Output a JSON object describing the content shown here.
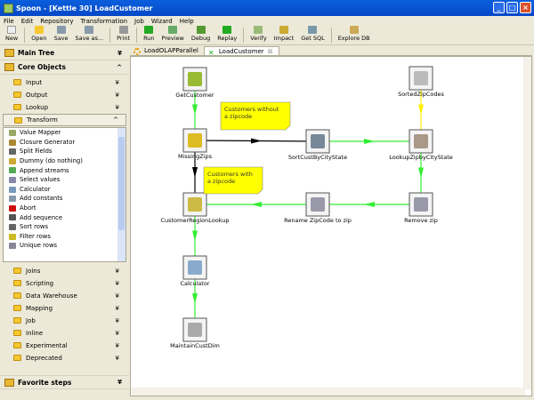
{
  "window": {
    "title": "Spoon - [Kettle 30] LoadCustomer"
  },
  "menu": [
    "File",
    "Edit",
    "Repository",
    "Transformation",
    "Job",
    "Wizard",
    "Help"
  ],
  "toolbar": [
    "New",
    "Open",
    "Save",
    "Save as...",
    "Print",
    "Run",
    "Preview",
    "Debug",
    "Replay",
    "Verify",
    "Impact",
    "Get SQL",
    "Explore DB"
  ],
  "left": {
    "main_tree": "Main Tree",
    "core_objects": "Core Objects",
    "categories_top": [
      "Input",
      "Output",
      "Lookup"
    ],
    "transform": "Transform",
    "transform_items": [
      "Value Mapper",
      "Closure Generator",
      "Split Fields",
      "Dummy (do nothing)",
      "Append streams",
      "Select values",
      "Calculator",
      "Add constants",
      "Abort",
      "Add sequence",
      "Sort rows",
      "Filter rows",
      "Unique rows"
    ],
    "categories_bottom": [
      "Joins",
      "Scripting",
      "Data Warehouse",
      "Mapping",
      "Job",
      "Inline",
      "Experimental",
      "Deprecated"
    ],
    "favorite": "Favorite steps"
  },
  "tabs": [
    "LoadOLAPParallel",
    "LoadCustomer"
  ],
  "steps": {
    "get_customer": "GetCustomer",
    "missing_zips": "MissingZips",
    "sort": "SortCustByCityState",
    "lookup_zip": "LookupZipbyCityState",
    "sorted_zip": "SortedZipCodes",
    "region": "CustomerRegionLookup",
    "rename": "Rename ZipCode to zip",
    "remove": "Remove zip",
    "calculator": "Calculator",
    "maintain": "MaintainCustDim"
  },
  "notes": {
    "without": [
      "Customers without",
      "a zipcode"
    ],
    "with": [
      "Customers with",
      "a zipcode"
    ]
  },
  "colors": {
    "hop_ok": "#33ee33",
    "hop_false": "#000000",
    "hop_info": "#ffee00",
    "note": "#ffff00"
  }
}
